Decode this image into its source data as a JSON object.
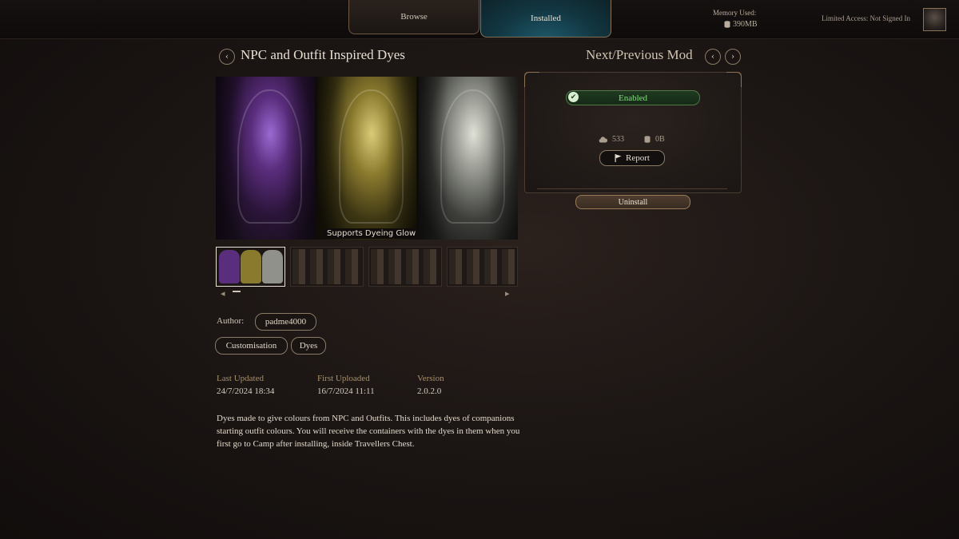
{
  "topbar": {
    "tabs": [
      {
        "label": "Browse"
      },
      {
        "label": "Installed"
      }
    ],
    "memory_label": "Memory Used:",
    "memory_value": "390MB",
    "access_status": "Limited Access: Not Signed In"
  },
  "mod": {
    "title": "NPC and Outfit Inspired Dyes",
    "nav_label": "Next/Previous Mod",
    "image_caption": "Supports Dyeing Glow",
    "author_label": "Author:",
    "author": "padme4000",
    "tags": [
      "Customisation",
      "Dyes"
    ],
    "meta": {
      "last_updated_label": "Last Updated",
      "last_updated": "24/7/2024 18:34",
      "first_uploaded_label": "First Uploaded",
      "first_uploaded": "16/7/2024 11:11",
      "version_label": "Version",
      "version": "2.0.2.0"
    },
    "description": "Dyes made to give colours from NPC and Outfits. This includes dyes of companions starting outfit colours. You will receive the containers with the dyes in them when you first go to Camp after installing, inside Travellers Chest."
  },
  "side": {
    "status": "Enabled",
    "downloads": "533",
    "size": "0B",
    "report_label": "Report",
    "uninstall_label": "Uninstall"
  },
  "colors": {
    "accent_teal": "#123742",
    "enabled_green": "#7fe07a",
    "gold_text": "#a9906a"
  }
}
